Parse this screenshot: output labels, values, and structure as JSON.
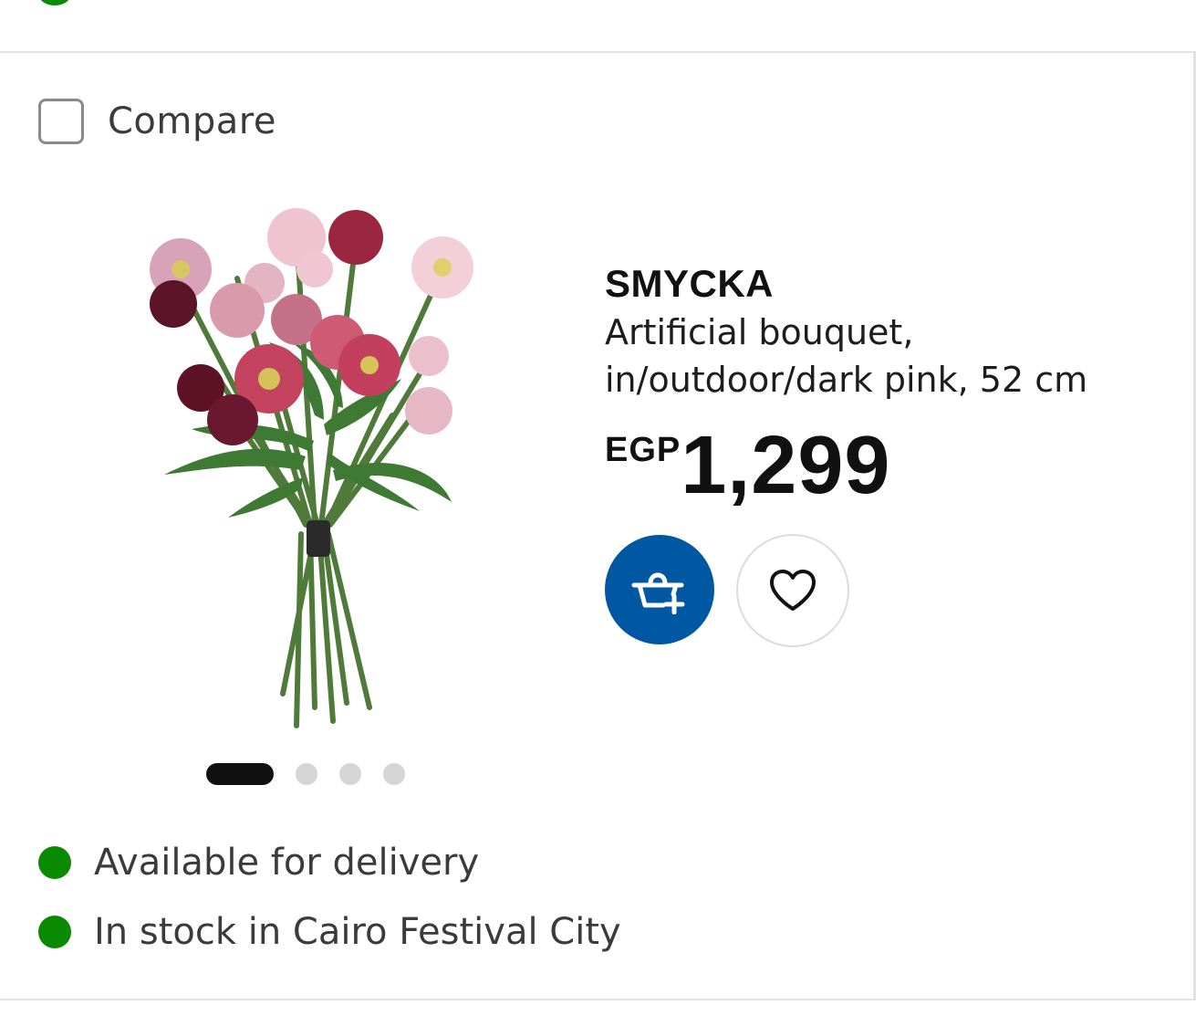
{
  "compare": {
    "label": "Compare",
    "checked": false
  },
  "product": {
    "name": "SMYCKA",
    "description_line1": "Artificial bouquet,",
    "description_line2": "in/outdoor/dark pink, 52 cm",
    "currency": "EGP",
    "price": "1,299",
    "image_alt": "Artificial bouquet with pink and dark red flowers"
  },
  "carousel": {
    "total": 4,
    "active_index": 0
  },
  "actions": {
    "add_to_cart_icon": "basket-plus-icon",
    "favourite_icon": "heart-icon"
  },
  "availability": {
    "delivery": "Available for delivery",
    "stock": "In stock in Cairo Festival City",
    "status_color": "#0a8a00"
  },
  "colors": {
    "accent": "#0058a3",
    "text": "#111111",
    "muted_text": "#3b3b3b",
    "divider": "#e2e2e2"
  }
}
